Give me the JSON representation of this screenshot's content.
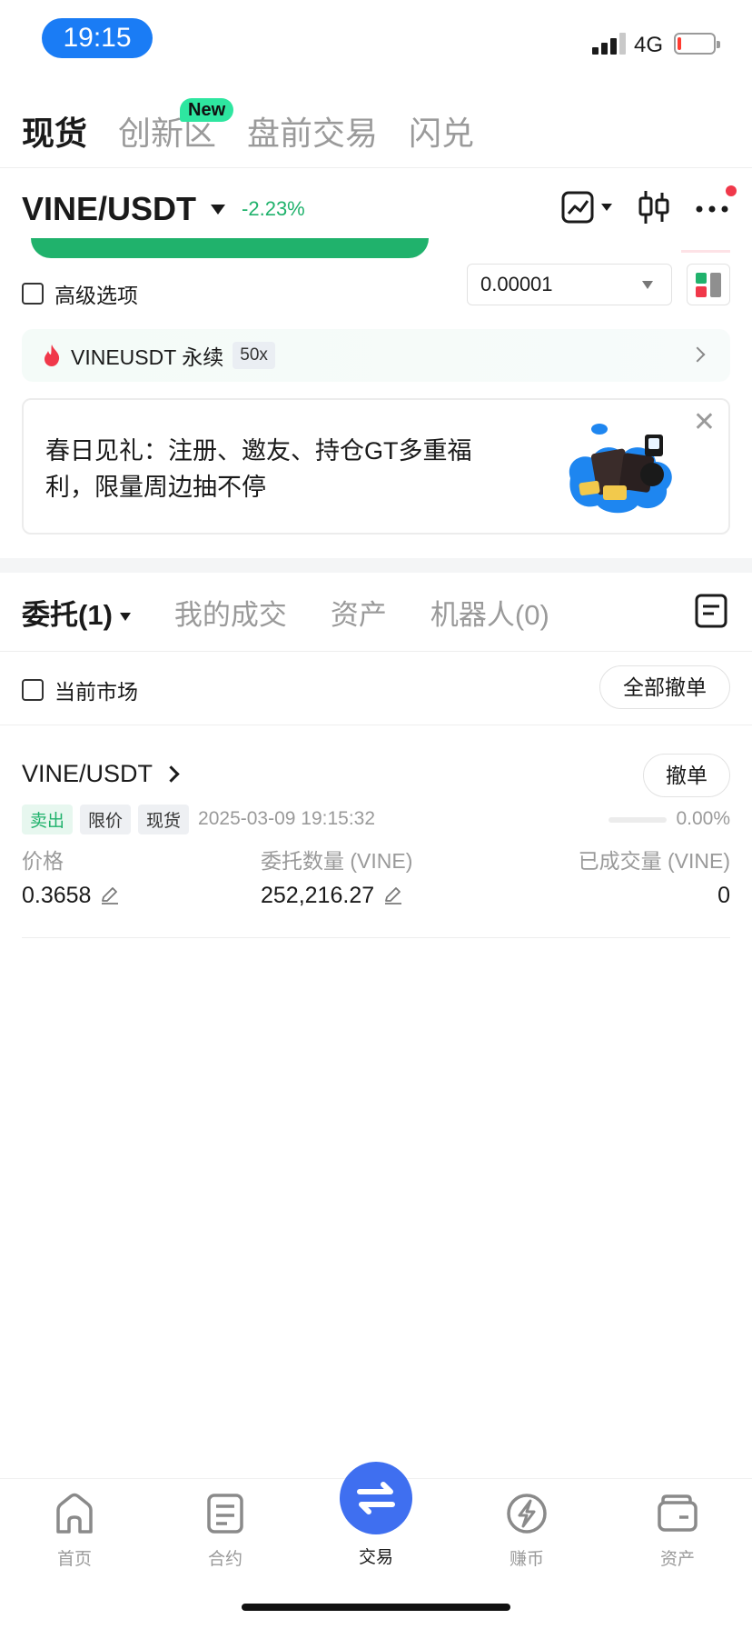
{
  "status_bar": {
    "time": "19:15",
    "network": "4G"
  },
  "top_tabs": [
    {
      "label": "现货",
      "active": true
    },
    {
      "label": "创新区",
      "badge": "New"
    },
    {
      "label": "盘前交易"
    },
    {
      "label": "闪兑"
    }
  ],
  "pair": {
    "name": "VINE/USDT",
    "change": "-2.23%"
  },
  "header_icons": [
    "chart-line-icon",
    "candlestick-icon",
    "more-icon"
  ],
  "form": {
    "advanced_label": "高级选项",
    "precision_value": "0.00001"
  },
  "perp": {
    "label": "VINEUSDT 永续",
    "leverage": "50x"
  },
  "promo": {
    "text": "春日见礼：注册、邀友、持仓GT多重福利，限量周边抽不停",
    "close": "✕"
  },
  "order_tabs": [
    {
      "label": "委托(1)",
      "active": true
    },
    {
      "label": "我的成交"
    },
    {
      "label": "资产"
    },
    {
      "label": "机器人(0)"
    }
  ],
  "filters": {
    "current_market": "当前市场",
    "cancel_all": "全部撤单"
  },
  "order": {
    "pair": "VINE/USDT",
    "cancel": "撤单",
    "side": "卖出",
    "type": "限价",
    "market": "现货",
    "time": "2025-03-09 19:15:32",
    "progress_text": "0.00%",
    "filled_fraction": 0,
    "price_label": "价格",
    "price": "0.3658",
    "amount_label": "委托数量 (VINE)",
    "amount": "252,216.27",
    "filled_label": "已成交量 (VINE)",
    "filled": "0"
  },
  "bottom_nav": [
    {
      "label": "首页",
      "icon": "home-icon"
    },
    {
      "label": "合约",
      "icon": "contract-icon"
    },
    {
      "label": "交易",
      "icon": "trade-icon",
      "active": true
    },
    {
      "label": "赚币",
      "icon": "earn-icon"
    },
    {
      "label": "资产",
      "icon": "wallet-icon"
    }
  ],
  "colors": {
    "accent": "#3f6ff0",
    "up_green": "#20b26c",
    "time_pill": "#1a7cf5",
    "alert_red": "#f0384a"
  }
}
